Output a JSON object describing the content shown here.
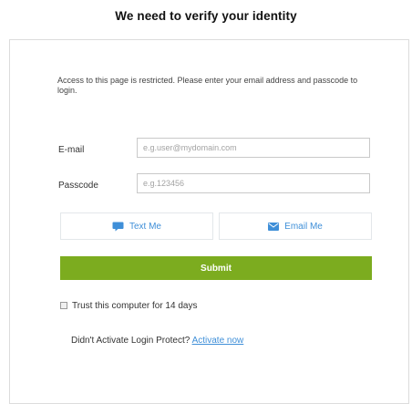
{
  "page": {
    "title": "We need to verify your identity"
  },
  "card": {
    "intro": "Access to this page is restricted. Please enter your email address and passcode to login.",
    "email": {
      "label": "E-mail",
      "placeholder": "e.g.user@mydomain.com",
      "value": ""
    },
    "passcode": {
      "label": "Passcode",
      "placeholder": "e.g.123456",
      "value": ""
    },
    "methods": {
      "text_me": {
        "label": "Text Me",
        "icon": "chat-bubble-icon"
      },
      "email_me": {
        "label": "Email Me",
        "icon": "envelope-icon"
      }
    },
    "submit_label": "Submit",
    "trust": {
      "label": "Trust this computer for 14 days",
      "checked": false
    },
    "footer": {
      "prompt": "Didn't Activate Login Protect?",
      "link_label": "Activate now"
    }
  },
  "colors": {
    "accent_green": "#7cac1f",
    "link_blue": "#3f8fd8",
    "border": "#dcdcdc"
  }
}
